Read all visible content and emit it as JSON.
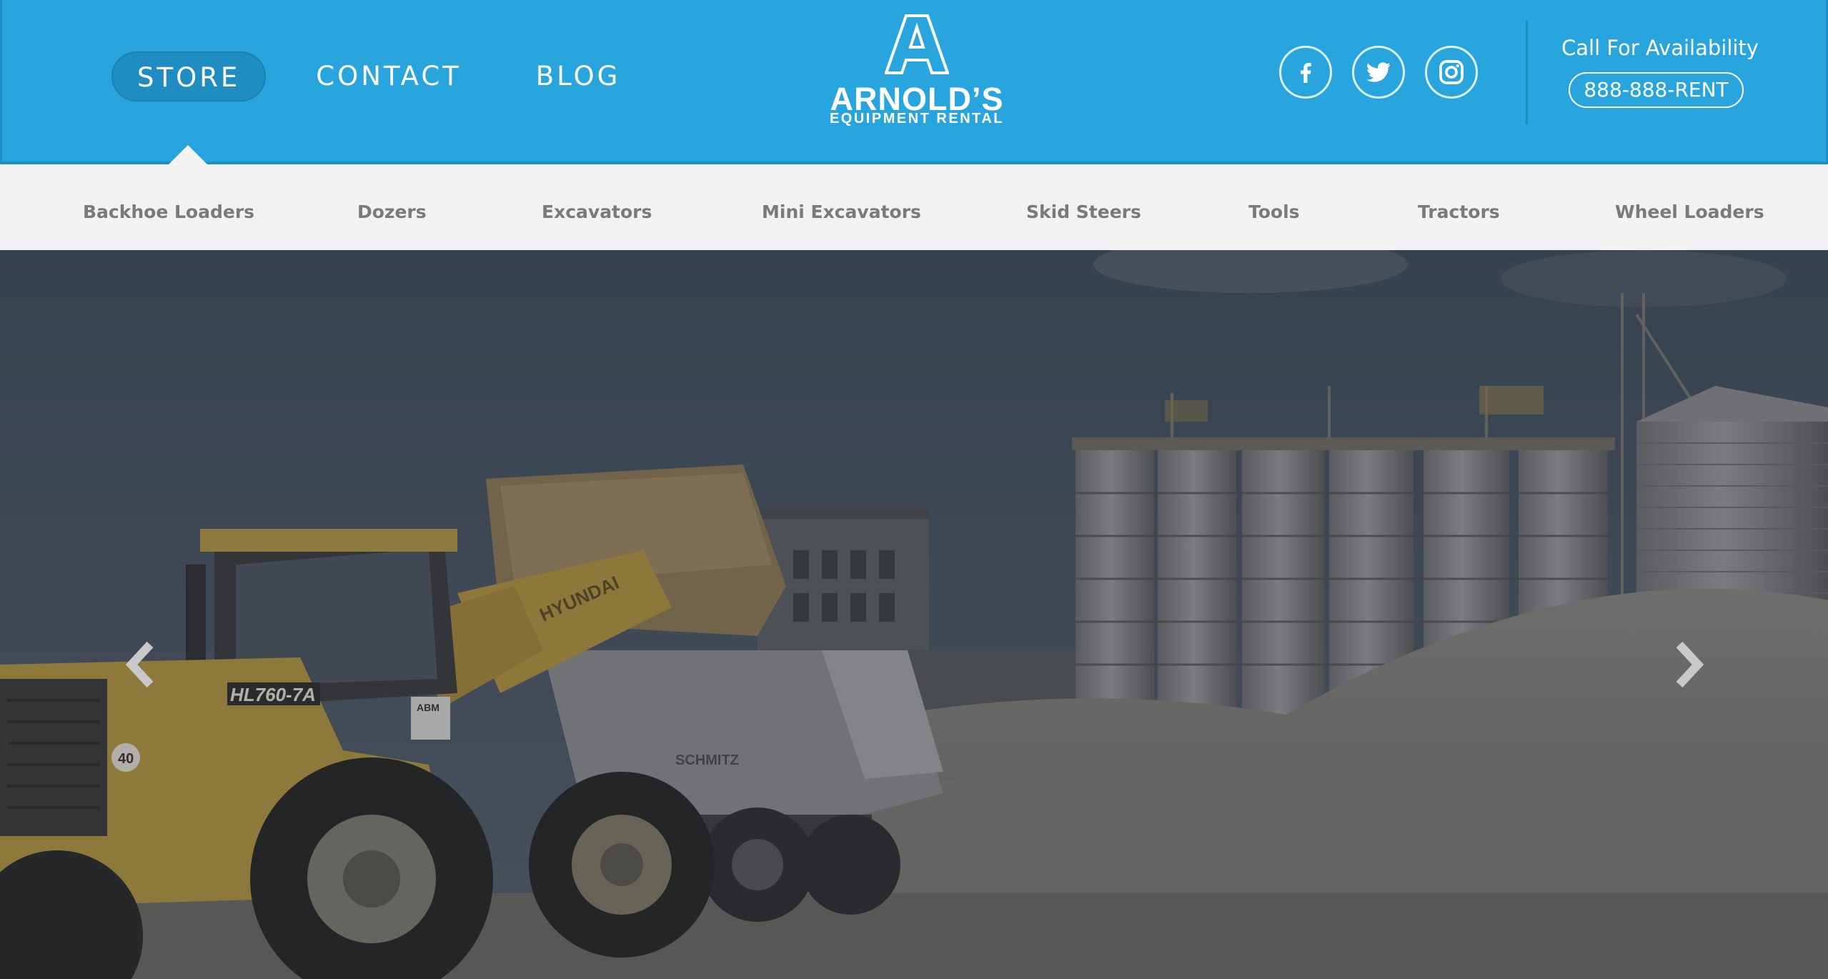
{
  "header": {
    "nav": [
      {
        "label": "STORE",
        "active": true
      },
      {
        "label": "CONTACT",
        "active": false
      },
      {
        "label": "BLOG",
        "active": false
      }
    ],
    "logo": {
      "letter": "A",
      "name": "ARNOLD’S",
      "tagline": "EQUIPMENT RENTAL"
    },
    "social": [
      "facebook-icon",
      "twitter-icon",
      "instagram-icon"
    ],
    "call_label": "Call For Availability",
    "phone": "888-888-RENT"
  },
  "categories": [
    "Backhoe Loaders",
    "Dozers",
    "Excavators",
    "Mini Excavators",
    "Skid Steers",
    "Tools",
    "Tractors",
    "Wheel Loaders"
  ],
  "hero": {
    "loader_model": "HL760-7A",
    "loader_brand": "HYUNDAI",
    "truck_brand": "SCHMITZ",
    "speed_label": "40",
    "sticker": "ABM"
  },
  "colors": {
    "header_bg": "#27a5dc",
    "header_border": "#1d8fc2",
    "category_bar_bg": "#f2f2f2",
    "category_text": "#7a7a7a"
  }
}
